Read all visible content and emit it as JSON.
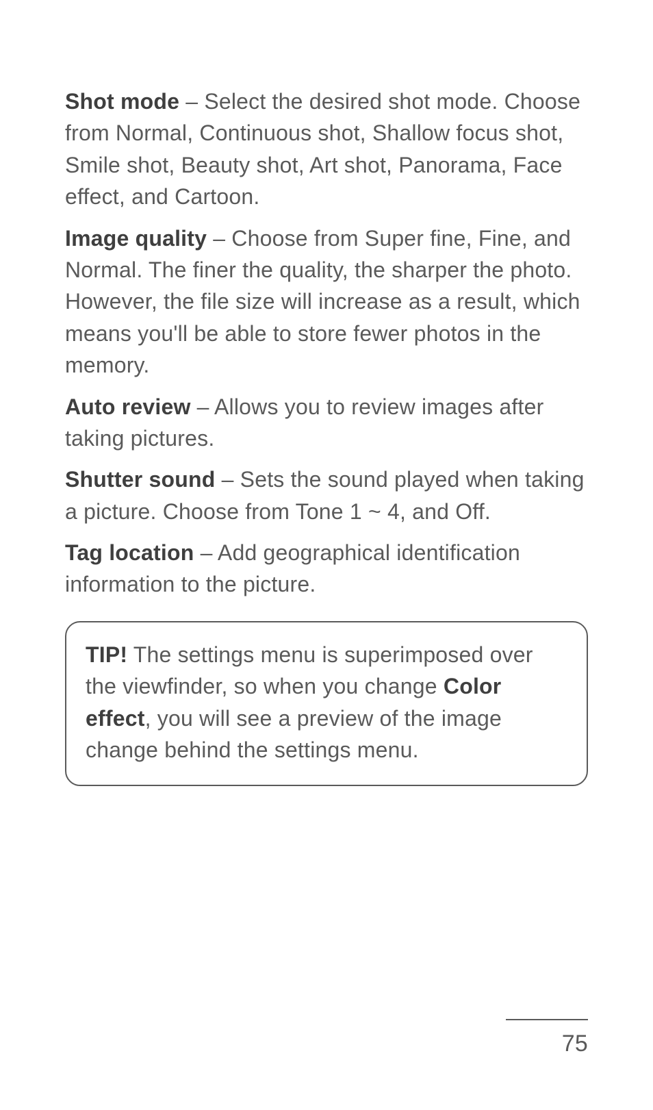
{
  "settings": [
    {
      "title": "Shot mode",
      "sep": " – ",
      "body": "Select the desired shot mode. Choose from Normal, Continuous shot, Shallow focus shot, Smile shot, Beauty shot, Art shot, Panorama, Face effect, and Cartoon."
    },
    {
      "title": "Image quality",
      "sep": " – ",
      "body": "Choose from Super fine, Fine, and Normal. The finer the quality, the sharper the photo. However, the file size will increase as a result, which means you'll be able to store fewer photos in the memory."
    },
    {
      "title": "Auto review",
      "sep": " – ",
      "body": "Allows you to review images after taking pictures."
    },
    {
      "title": "Shutter sound",
      "sep": " – ",
      "body": "Sets the sound played when taking a picture. Choose from Tone 1 ~ 4, and Off."
    },
    {
      "title": "Tag location",
      "sep": " – ",
      "body": "Add geographical identification information to the picture."
    }
  ],
  "tip": {
    "label": "TIP!",
    "before": " The settings menu is superimposed over the viewfinder, so when you change ",
    "emph": "Color effect",
    "after": ", you will see a preview of the image change behind the settings menu."
  },
  "page_number": "75"
}
